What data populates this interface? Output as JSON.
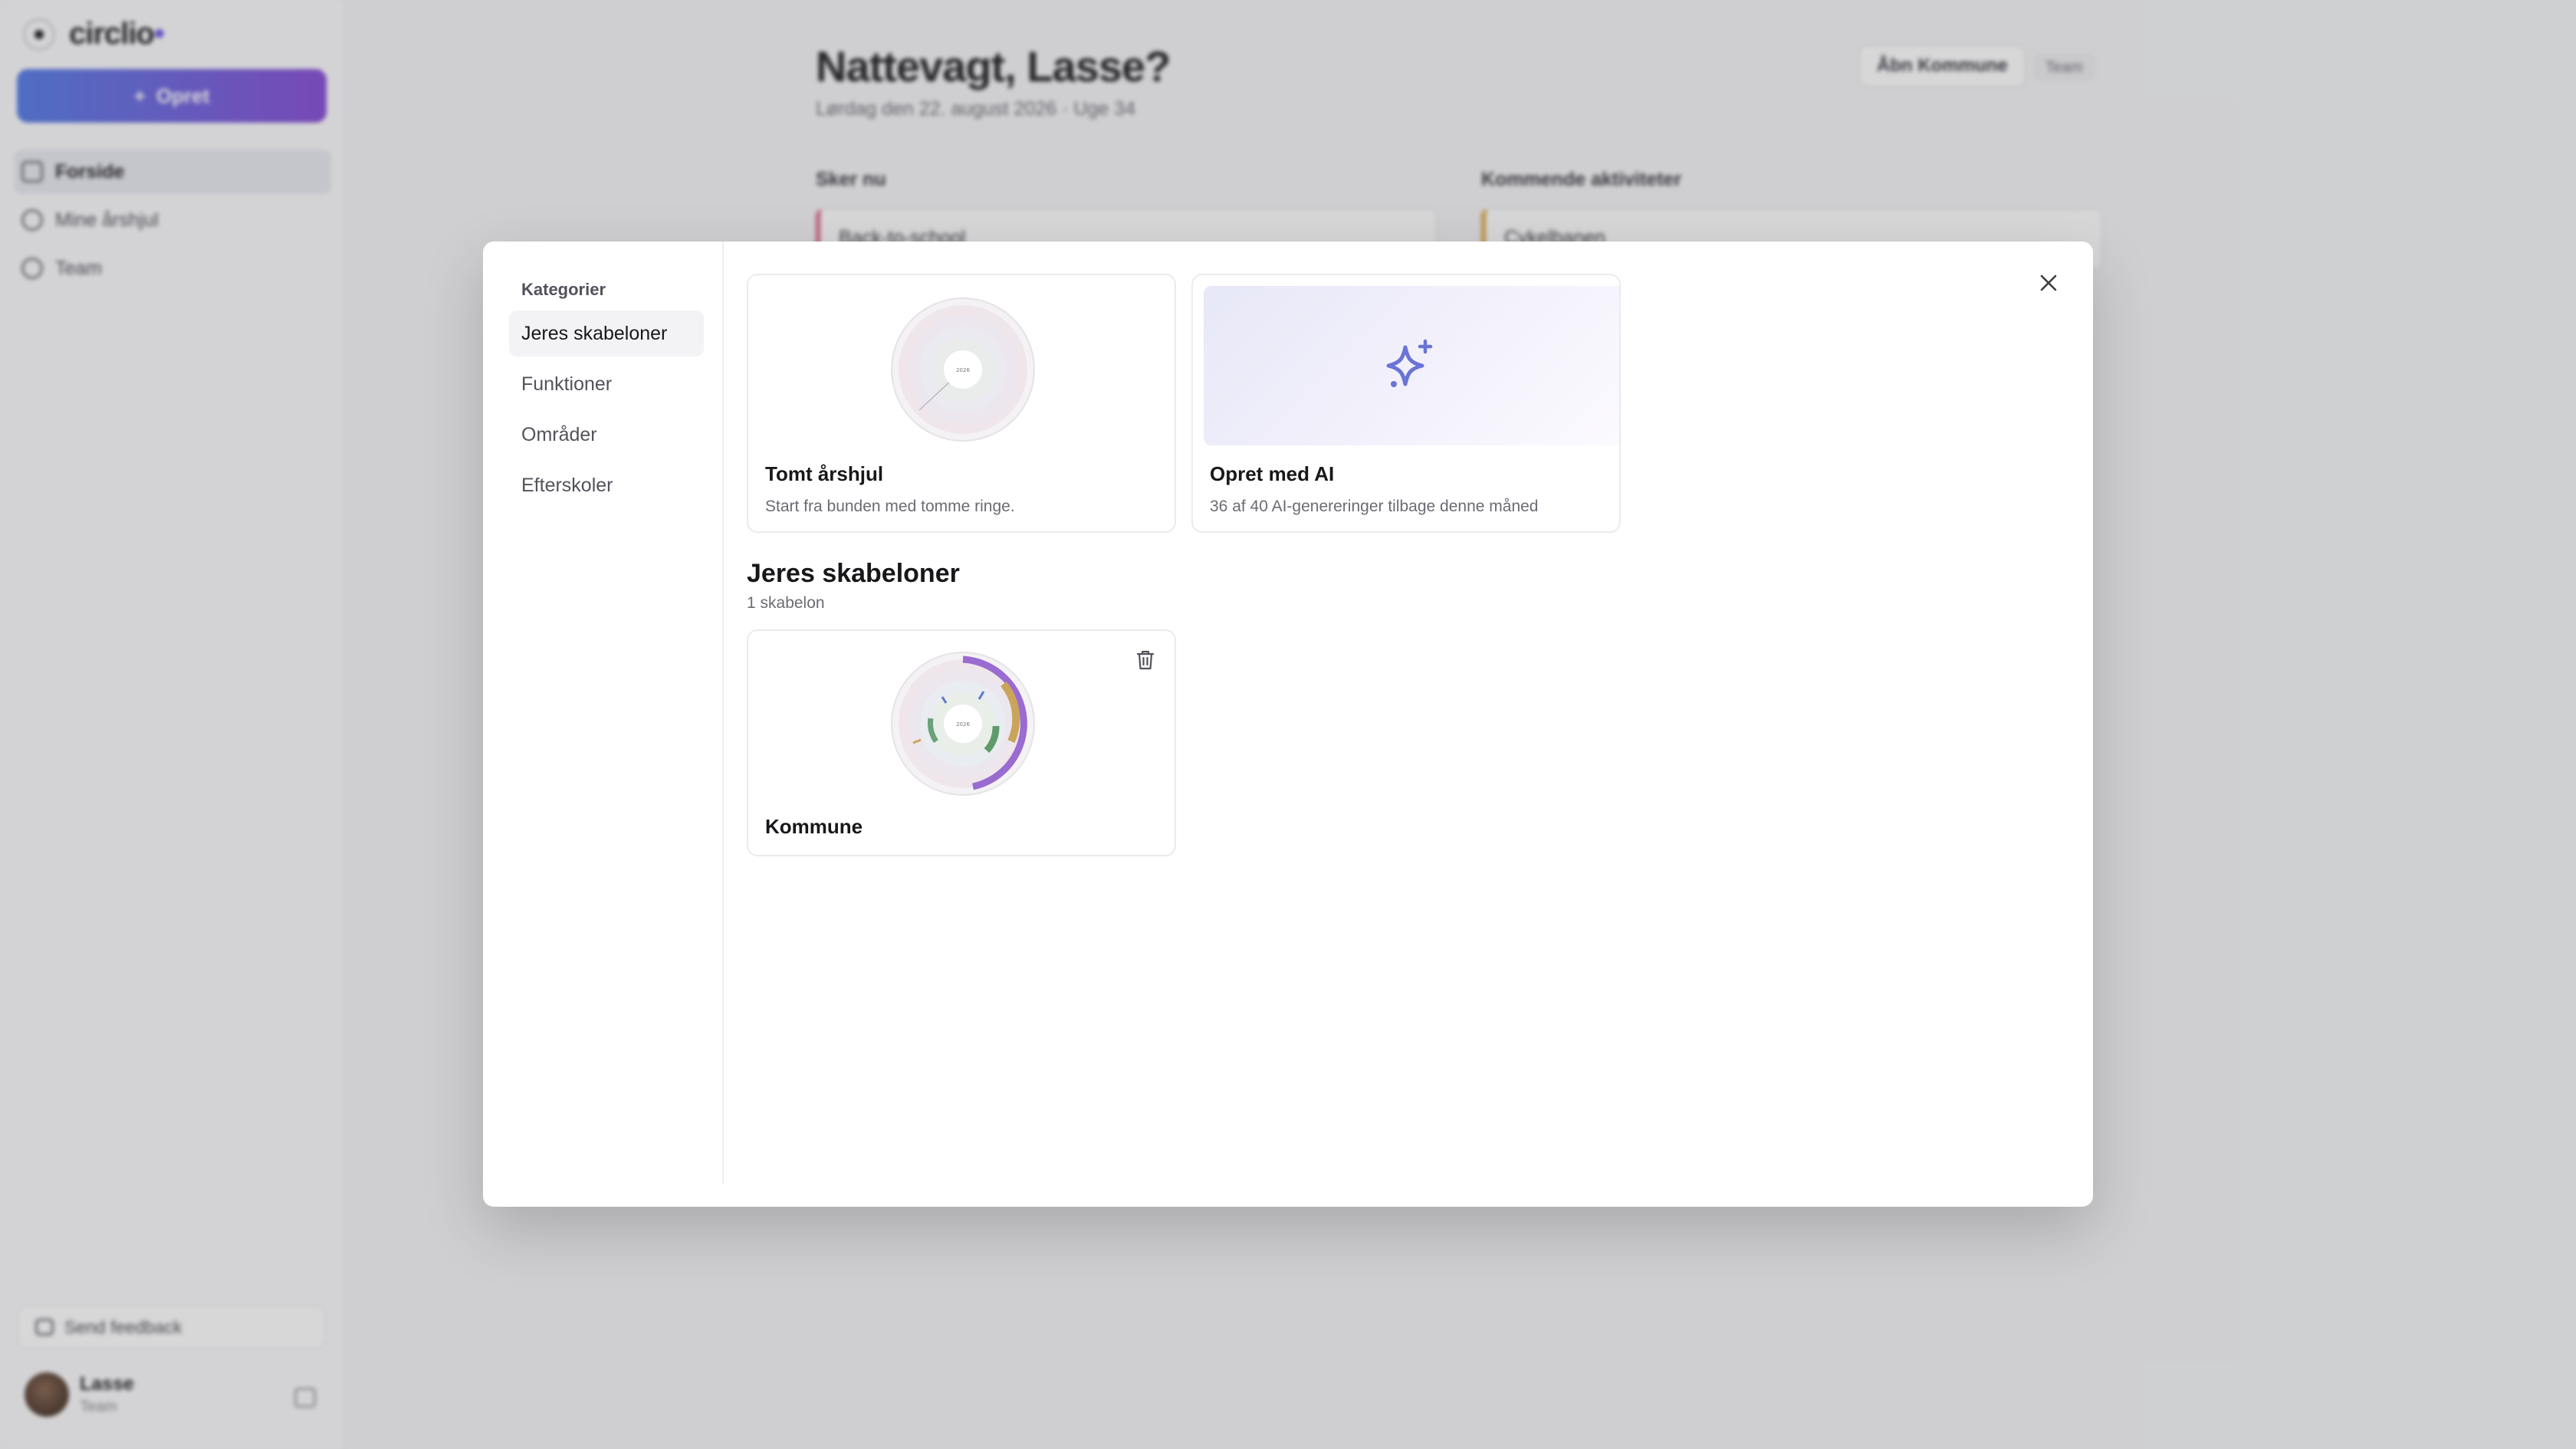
{
  "sidebar": {
    "logo_text": "circlio",
    "logo_dot": "•",
    "create_label": "Opret",
    "items": [
      {
        "label": "Forside",
        "icon": "home-icon"
      },
      {
        "label": "Mine årshjul",
        "icon": "circle-icon"
      },
      {
        "label": "Team",
        "icon": "users-icon"
      }
    ],
    "feedback_label": "Send feedback",
    "user": {
      "name": "Lasse",
      "role": "Team"
    }
  },
  "main": {
    "title": "Nattevagt, Lasse?",
    "subtitle": "Lørdag den 22. august 2026 · Uge 34",
    "open_button": "Åbn Kommune",
    "badge": "Team",
    "section_now": "Sker nu",
    "section_upcoming": "Kommende aktiviteter",
    "now_card": "Back-to-school",
    "upcoming_card": "Cykelbanen"
  },
  "modal": {
    "categories_heading": "Kategorier",
    "categories": [
      "Jeres skabeloner",
      "Funktioner",
      "Områder",
      "Efterskoler"
    ],
    "active_category": 0,
    "cards": {
      "empty": {
        "title": "Tomt årshjul",
        "description": "Start fra bunden med tomme ringe.",
        "wheel_label": "2026"
      },
      "ai": {
        "title": "Opret med AI",
        "description": "36 af 40 AI-genereringer tilbage denne måned",
        "icon": "sparkle-icon"
      }
    },
    "section_title": "Jeres skabeloner",
    "section_count": "1 skabelon",
    "templates": [
      {
        "title": "Kommune",
        "wheel_label": "2026"
      }
    ]
  },
  "colors": {
    "accent": "#6a73d6",
    "create_gradient_start": "#5a7fe6",
    "create_gradient_end": "#8a52d6",
    "now_bar": "#e06a8a",
    "upcoming_bar": "#e0a84a"
  }
}
